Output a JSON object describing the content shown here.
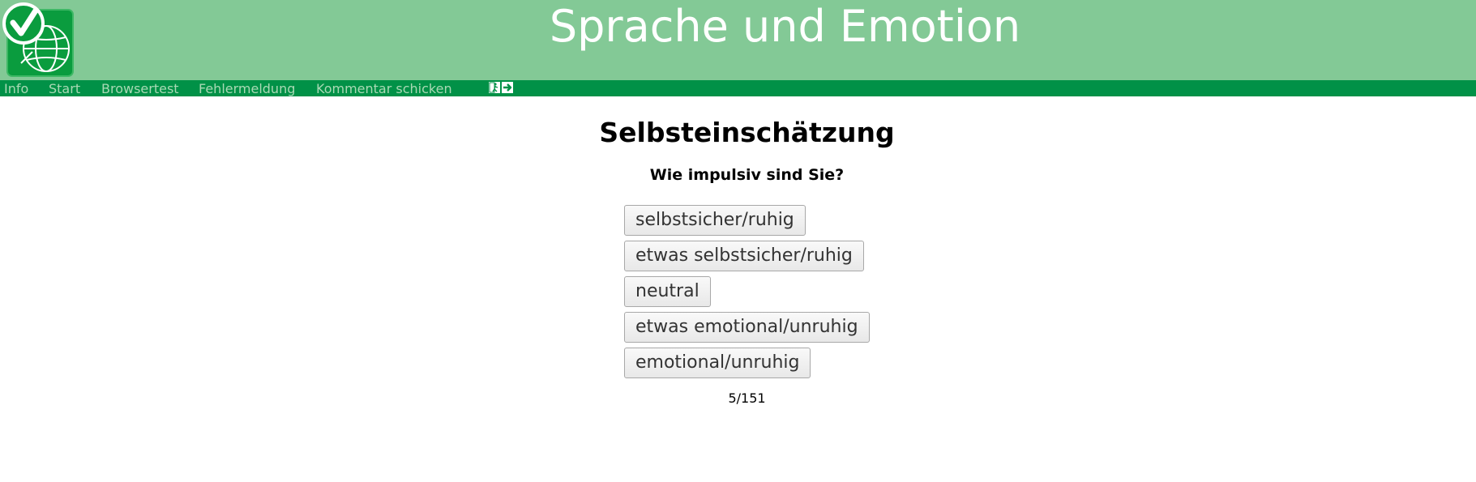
{
  "header": {
    "title": "Sprache und Emotion",
    "logo_icon": "checkmark-globe-icon",
    "background": "#83c996"
  },
  "nav": {
    "background": "#019147",
    "links": [
      {
        "label": "Info"
      },
      {
        "label": "Start"
      },
      {
        "label": "Browsertest"
      },
      {
        "label": "Fehlermeldung"
      },
      {
        "label": "Kommentar schicken"
      }
    ],
    "icons": [
      "exit-person-icon",
      "arrow-right-icon"
    ]
  },
  "main": {
    "title": "Selbsteinschätzung",
    "question": "Wie impulsiv sind Sie?",
    "answers": [
      {
        "label": "selbstsicher/ruhig"
      },
      {
        "label": "etwas selbstsicher/ruhig"
      },
      {
        "label": "neutral"
      },
      {
        "label": "etwas emotional/unruhig"
      },
      {
        "label": "emotional/unruhig"
      }
    ],
    "progress": "5/151"
  }
}
